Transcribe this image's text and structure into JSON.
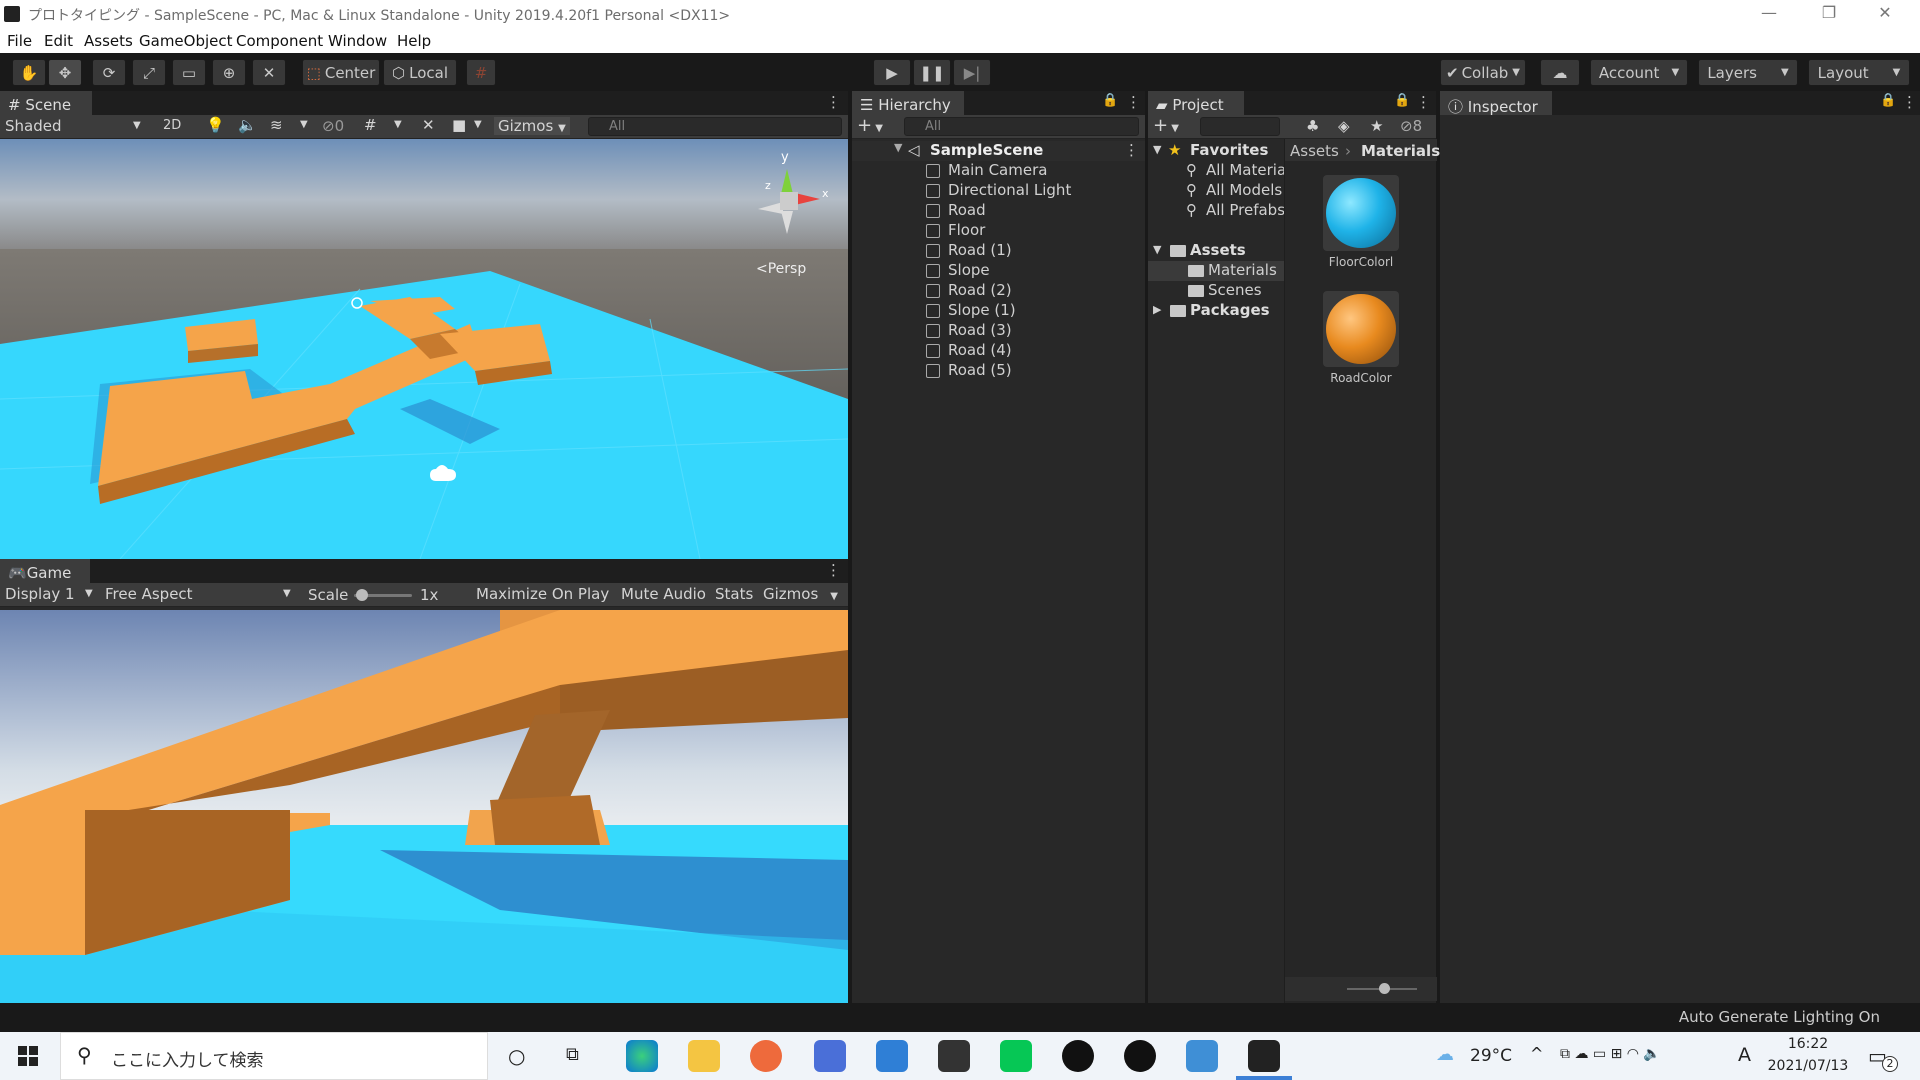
{
  "window": {
    "title": "プロトタイピング - SampleScene - PC, Mac & Linux Standalone - Unity 2019.4.20f1 Personal <DX11>"
  },
  "menu": [
    "File",
    "Edit",
    "Assets",
    "GameObject",
    "Component",
    "Window",
    "Help"
  ],
  "toolbar": {
    "pivot": "Center",
    "space": "Local",
    "collab": "Collab",
    "account": "Account",
    "layers": "Layers",
    "layout": "Layout"
  },
  "scene": {
    "tab": "Scene",
    "shading": "Shaded",
    "mode2d": "2D",
    "hidden_count": "0",
    "gizmos": "Gizmos",
    "search_placeholder": "All",
    "persp": "Persp",
    "axis_y": "y",
    "axis_x": "x",
    "axis_z": "z"
  },
  "game": {
    "tab": "Game",
    "display": "Display 1",
    "aspect": "Free Aspect",
    "scale_label": "Scale",
    "scale_value": "1x",
    "maximize": "Maximize On Play",
    "mute": "Mute Audio",
    "stats": "Stats",
    "gizmos": "Gizmos"
  },
  "hierarchy": {
    "tab": "Hierarchy",
    "search_placeholder": "All",
    "scene_name": "SampleScene",
    "items": [
      "Main Camera",
      "Directional Light",
      "Road",
      "Floor",
      "Road (1)",
      "Slope",
      "Road (2)",
      "Slope (1)",
      "Road (3)",
      "Road (4)",
      "Road (5)"
    ]
  },
  "project": {
    "tab": "Project",
    "hidden_count": "8",
    "favorites": "Favorites",
    "fav_items": [
      "All Materia",
      "All Models",
      "All Prefabs"
    ],
    "assets": "Assets",
    "asset_items": [
      "Materials",
      "Scenes"
    ],
    "packages": "Packages",
    "breadcrumb_root": "Assets",
    "breadcrumb_current": "Materials",
    "materials": [
      {
        "name": "FloorColorl",
        "color": "#1fb3e8"
      },
      {
        "name": "RoadColor",
        "color": "#e88a1f"
      }
    ]
  },
  "inspector": {
    "tab": "Inspector"
  },
  "statusbar": {
    "text": "Auto Generate Lighting On"
  },
  "taskbar": {
    "search_placeholder": "ここに入力して検索",
    "weather": "29°C",
    "ime": "A",
    "time": "16:22",
    "date": "2021/07/13",
    "notification_count": "2"
  },
  "colors": {
    "floor": "#33d6ff",
    "road": "#f5a44a",
    "sky_top": "#6d8fb8"
  }
}
